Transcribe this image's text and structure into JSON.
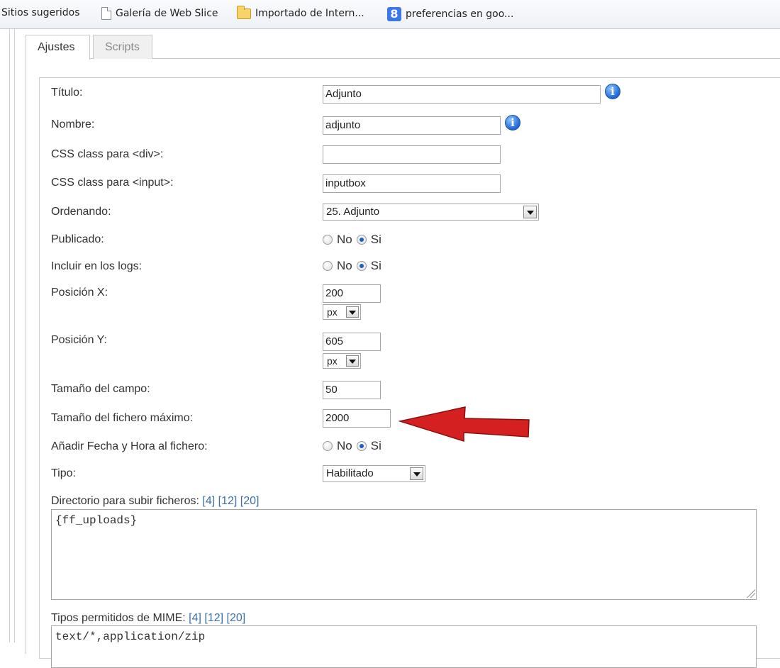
{
  "favorites_bar": {
    "items": [
      {
        "label": "Sitios sugeridos",
        "icon": "none"
      },
      {
        "label": "Galería de Web Slice",
        "icon": "page-icon"
      },
      {
        "label": "Importado de Intern...",
        "icon": "folder-icon"
      },
      {
        "label": "preferencias en goo...",
        "icon": "google-icon"
      }
    ]
  },
  "tabs": [
    {
      "label": "Ajustes",
      "active": true
    },
    {
      "label": "Scripts",
      "active": false
    }
  ],
  "form": {
    "titulo": {
      "label": "Título:",
      "value": "Adjunto"
    },
    "nombre": {
      "label": "Nombre:",
      "value": "adjunto"
    },
    "css_div": {
      "label": "CSS class para <div>:",
      "value": ""
    },
    "css_input": {
      "label": "CSS class para <input>:",
      "value": "inputbox"
    },
    "ordenando": {
      "label": "Ordenando:",
      "value": "25. Adjunto"
    },
    "publicado": {
      "label": "Publicado:",
      "options": [
        "No",
        "Si"
      ],
      "selected": "Si"
    },
    "incluir_logs": {
      "label": "Incluir en los logs:",
      "options": [
        "No",
        "Si"
      ],
      "selected": "Si"
    },
    "posicion_x": {
      "label": "Posición X:",
      "value": "200",
      "unit": "px"
    },
    "posicion_y": {
      "label": "Posición Y:",
      "value": "605",
      "unit": "px"
    },
    "tamano_campo": {
      "label": "Tamaño del campo:",
      "value": "50"
    },
    "tamano_fichero": {
      "label": "Tamaño del fichero máximo:",
      "value": "2000"
    },
    "anadir_fecha": {
      "label": "Añadir Fecha y Hora al fichero:",
      "options": [
        "No",
        "Si"
      ],
      "selected": "Si"
    },
    "tipo": {
      "label": "Tipo:",
      "value": "Habilitado"
    },
    "directorio": {
      "label": "Directorio para subir ficheros:",
      "refs": "[4] [12] [20]",
      "value": "{ff_uploads}"
    },
    "mime": {
      "label": "Tipos permitidos de MIME:",
      "refs": "[4] [12] [20]",
      "value": "text/*,application/zip"
    }
  },
  "colors": {
    "accent_arrow": "#d42020",
    "link": "#3a6fb0",
    "info_icon": "#1f66d6"
  }
}
